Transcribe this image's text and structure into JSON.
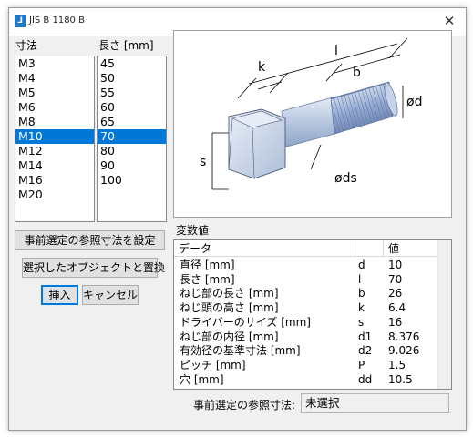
{
  "window": {
    "title": "JIS B 1180 B",
    "icon": "app-icon",
    "close_symbol": "✕"
  },
  "size_list": {
    "header": "寸法",
    "items": [
      "M3",
      "M4",
      "M5",
      "M6",
      "M8",
      "M10",
      "M12",
      "M14",
      "M16",
      "M20"
    ],
    "selected": "M10"
  },
  "length_list": {
    "header": "長さ [mm]",
    "items": [
      "45",
      "50",
      "55",
      "60",
      "65",
      "70",
      "80",
      "90",
      "100"
    ],
    "selected": "70"
  },
  "buttons": {
    "set_reference": "事前選定の参照寸法を設定",
    "replace_selected": "選択したオブジェクトと置換",
    "insert": "挿入",
    "cancel": "キャンセル"
  },
  "diagram_labels": {
    "l": "l",
    "k": "k",
    "b": "b",
    "d": "ød",
    "s": "s",
    "ds": "øds"
  },
  "variables": {
    "title": "変数値",
    "columns": [
      "データ",
      "",
      "値"
    ],
    "rows": [
      {
        "name": "直径 [mm]",
        "symbol": "d",
        "value": "10"
      },
      {
        "name": "長さ [mm]",
        "symbol": "l",
        "value": "70"
      },
      {
        "name": "ねじ部の長さ [mm]",
        "symbol": "b",
        "value": "26"
      },
      {
        "name": "ねじ頭の高さ [mm]",
        "symbol": "k",
        "value": "6.4"
      },
      {
        "name": "ドライバーのサイズ [mm]",
        "symbol": "s",
        "value": "16"
      },
      {
        "name": "ねじ部の内径 [mm]",
        "symbol": "d1",
        "value": "8.376"
      },
      {
        "name": "有効径の基準寸法 [mm]",
        "symbol": "d2",
        "value": "9.026"
      },
      {
        "name": "ピッチ [mm]",
        "symbol": "P",
        "value": "1.5"
      },
      {
        "name": "穴 [mm]",
        "symbol": "dd",
        "value": "10.5"
      }
    ]
  },
  "status": {
    "label": "事前選定の参照寸法:",
    "value": "未選択"
  },
  "colors": {
    "selection": "#0078d7",
    "bolt": "#b9c8e0",
    "default_button_border": "#0078d7"
  }
}
